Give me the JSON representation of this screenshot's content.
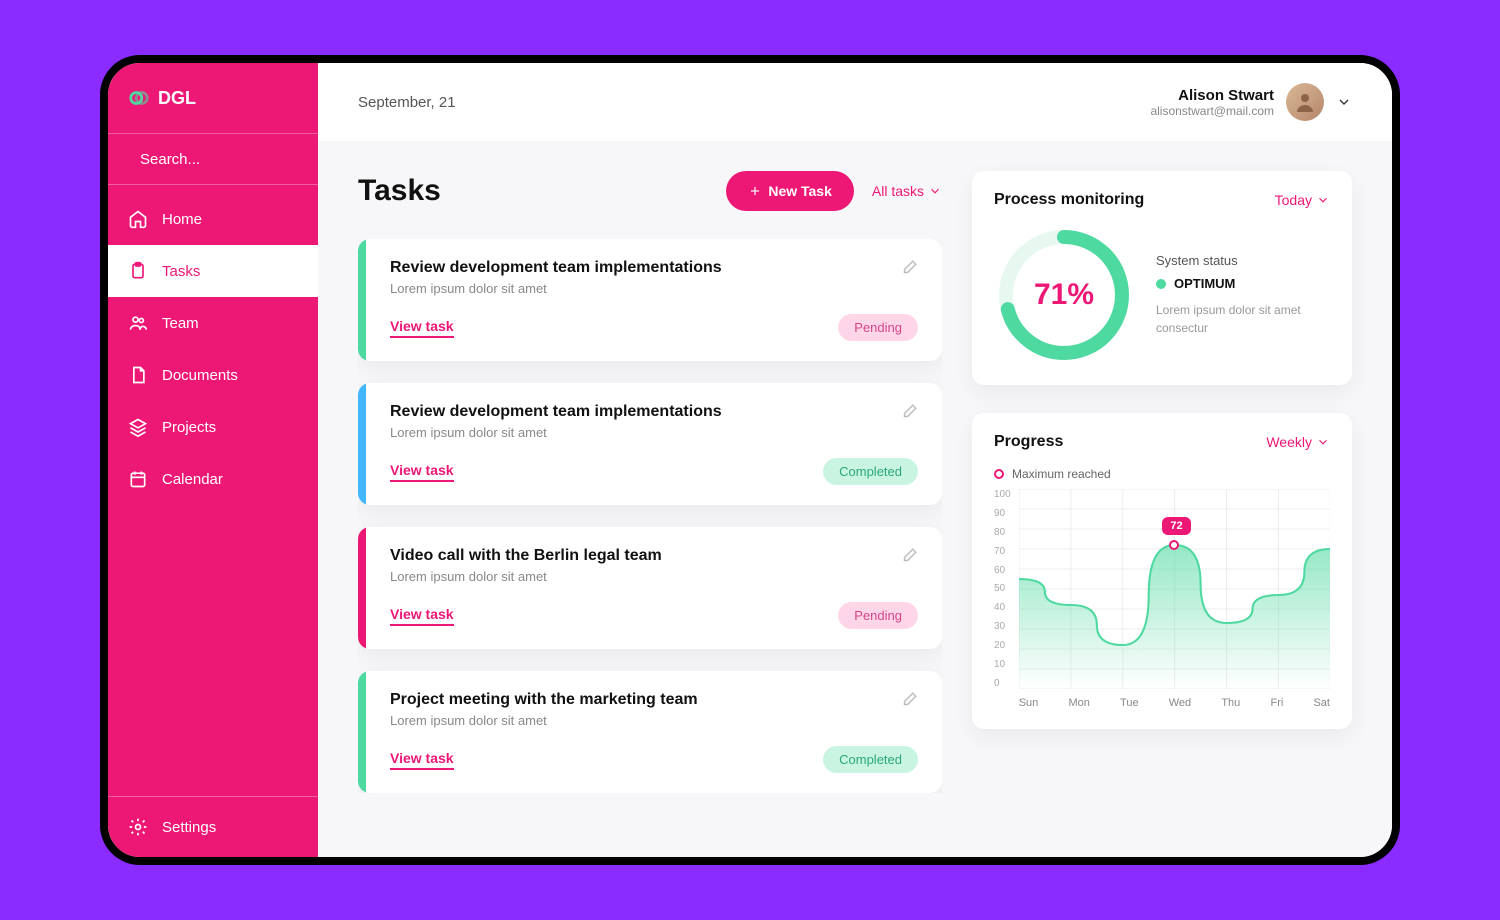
{
  "brand": "DGL",
  "search_placeholder": "Search...",
  "nav": {
    "home": "Home",
    "tasks": "Tasks",
    "team": "Team",
    "documents": "Documents",
    "projects": "Projects",
    "calendar": "Calendar",
    "settings": "Settings"
  },
  "topbar": {
    "date": "September, 21",
    "user_name": "Alison Stwart",
    "user_email": "alisonstwart@mail.com"
  },
  "tasks_section": {
    "title": "Tasks",
    "new_task": "New Task",
    "all_tasks": "All tasks",
    "items": [
      {
        "title": "Review development team implementations",
        "sub": "Lorem ipsum dolor sit amet",
        "view": "View task",
        "status": "Pending",
        "status_kind": "pending",
        "stripe": "#4ed9a0"
      },
      {
        "title": "Review development team implementations",
        "sub": "Lorem ipsum dolor sit amet",
        "view": "View task",
        "status": "Completed",
        "status_kind": "completed",
        "stripe": "#42b6ff"
      },
      {
        "title": "Video call with the Berlin legal team",
        "sub": "Lorem ipsum dolor sit amet",
        "view": "View task",
        "status": "Pending",
        "status_kind": "pending",
        "stripe": "#ed1776"
      },
      {
        "title": "Project meeting with the marketing team",
        "sub": "Lorem ipsum dolor sit amet",
        "view": "View task",
        "status": "Completed",
        "status_kind": "completed",
        "stripe": "#4ed9a0"
      }
    ]
  },
  "process_monitoring": {
    "title": "Process monitoring",
    "filter": "Today",
    "percent": 71,
    "percent_label": "71%",
    "status_label": "System status",
    "status_value": "OPTIMUM",
    "desc": "Lorem ipsum dolor sit amet consectur"
  },
  "progress": {
    "title": "Progress",
    "filter": "Weekly",
    "legend": "Maximum reached",
    "peak_value": "72"
  },
  "chart_data": {
    "type": "area",
    "categories": [
      "Sun",
      "Mon",
      "Tue",
      "Wed",
      "Thu",
      "Fri",
      "Sat"
    ],
    "values": [
      55,
      42,
      22,
      72,
      33,
      47,
      70
    ],
    "yticks": [
      0,
      10,
      20,
      30,
      40,
      50,
      60,
      70,
      80,
      90,
      100
    ],
    "ylim": [
      0,
      100
    ],
    "peak_index": 3,
    "peak_value": 72
  },
  "colors": {
    "accent": "#ed1776",
    "green": "#4ed9a0"
  }
}
